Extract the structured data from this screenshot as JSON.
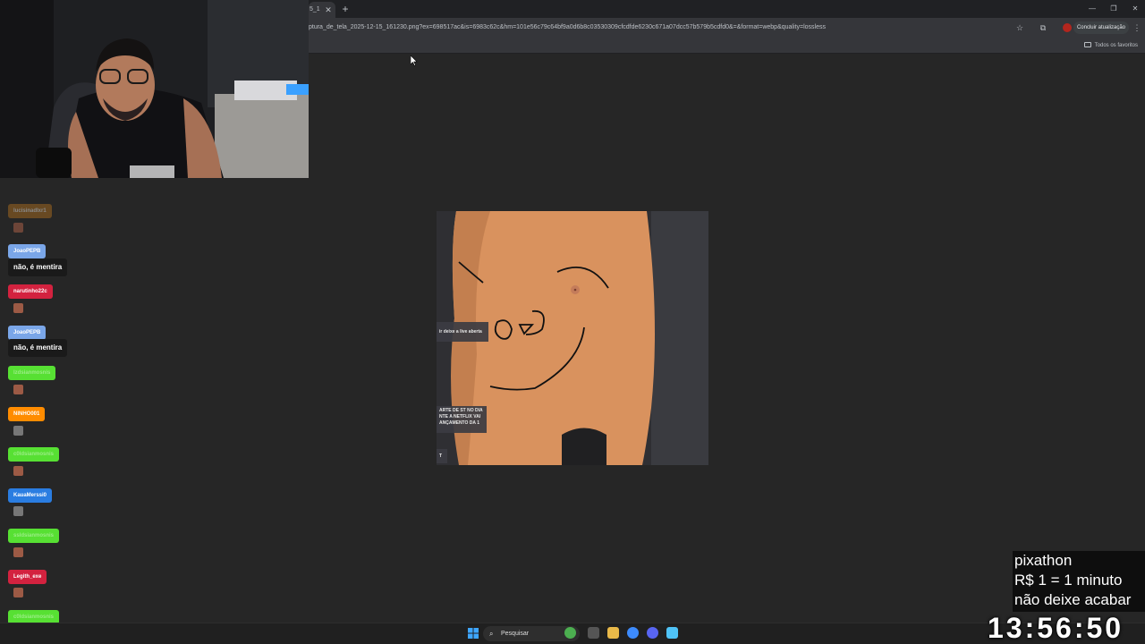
{
  "browser": {
    "tab_title": "5_1",
    "url": "ptura_de_tela_2025-12-15_161230.png?ex=698517ac&is=6983c62c&hm=101e56c79c64bf9a0d6b8c03530309cfcdfde6230c671a07dcc57b579b5cdfd0&=&format=webp&quality=lossless",
    "update_button": "Concluir atualização",
    "bookmarks_all": "Todos os favoritos"
  },
  "photo_overlays": {
    "left_label": "ir deixe a live aberta",
    "news_text": "ARTE DE ST NO DIA NTE A NETFLIX VAI ANÇAMENTO DA 1",
    "bottom_char": "T"
  },
  "chat": {
    "messages": [
      {
        "user": "lucisinadlxr1",
        "color": "#b8741f",
        "faded": true,
        "content": "emote"
      },
      {
        "user": "JoaoPEPB",
        "color": "#7aa6e8",
        "content": "text",
        "text": "não, é mentira"
      },
      {
        "user": "narutinho22c",
        "color": "#d3223f",
        "content": "emote"
      },
      {
        "user": "JoaoPEPB",
        "color": "#7aa6e8",
        "content": "text",
        "text": "não, é mentira"
      },
      {
        "user": "lzdsianmosnis",
        "color": "#57e033",
        "content": "emote"
      },
      {
        "user": "NINHO001",
        "color": "#ff8c00",
        "content": "emote-gray"
      },
      {
        "user": "c0ldsianmosnis",
        "color": "#57e033",
        "content": "emote"
      },
      {
        "user": "KauaMerssi0",
        "color": "#2a7de1",
        "content": "emote-gray"
      },
      {
        "user": "ssldsianmosnis",
        "color": "#57e033",
        "content": "emote"
      },
      {
        "user": "Legith_exe",
        "color": "#d3223f",
        "content": "emote"
      },
      {
        "user": "c0ldsianmosnis",
        "color": "#57e033",
        "content": "emote"
      }
    ]
  },
  "donation_overlay": {
    "line1": "pixathon",
    "line2": "R$ 1 = 1 minuto",
    "line3": "não deixe acabar",
    "timer": "13:56:50"
  },
  "taskbar": {
    "search_placeholder": "Pesquisar"
  }
}
